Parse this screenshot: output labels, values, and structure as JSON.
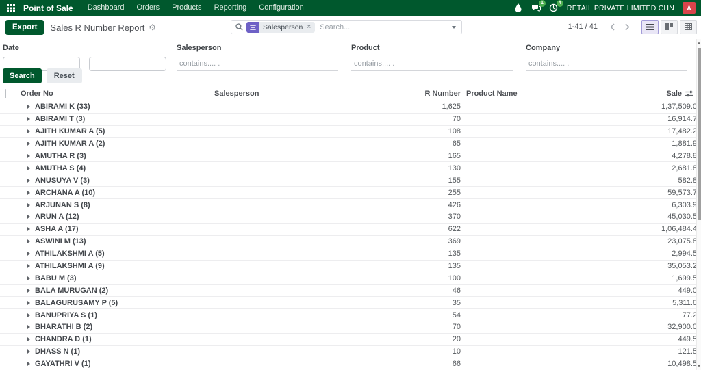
{
  "nav": {
    "app_name": "Point of Sale",
    "menus": [
      "Dashboard",
      "Orders",
      "Products",
      "Reporting",
      "Configuration"
    ],
    "messages_badge": "1",
    "activities_badge": "4",
    "company": "RETAIL PRIVATE LIMITED CHN",
    "avatar_letter": "A",
    "colors": {
      "navbar_bg": "#00582d",
      "avatar_bg": "#d9444b",
      "badge_bg": "#4caf50"
    }
  },
  "control_panel": {
    "export_label": "Export",
    "title": "Sales R Number Report",
    "gear_icon": "⚙",
    "search": {
      "facet_label": "Salesperson",
      "facet_remove": "×",
      "placeholder": "Search...",
      "facet_color": "#6e61c6"
    },
    "pager": {
      "text": "1-41 / 41"
    }
  },
  "filters": {
    "date": {
      "label": "Date"
    },
    "salesperson": {
      "label": "Salesperson",
      "placeholder": "contains.... ."
    },
    "product": {
      "label": "Product",
      "placeholder": "contains.... ."
    },
    "company": {
      "label": "Company",
      "placeholder": "contains.... ."
    },
    "search_button": "Search",
    "reset_button": "Reset"
  },
  "table": {
    "columns": {
      "order_no": "Order No",
      "salesperson": "Salesperson",
      "r_number": "R Number",
      "product_name": "Product Name",
      "sale": "Sale"
    },
    "groups": [
      {
        "name": "ABIRAMI K (33)",
        "r_number": "1,625",
        "sale": "1,37,509.0"
      },
      {
        "name": "ABIRAMI T (3)",
        "r_number": "70",
        "sale": "16,914.7"
      },
      {
        "name": "AJITH KUMAR A (5)",
        "r_number": "108",
        "sale": "17,482.2"
      },
      {
        "name": "AJITH KUMAR A (2)",
        "r_number": "65",
        "sale": "1,881.9"
      },
      {
        "name": "AMUTHA R (3)",
        "r_number": "165",
        "sale": "4,278.8"
      },
      {
        "name": "AMUTHA S (4)",
        "r_number": "130",
        "sale": "2,681.8"
      },
      {
        "name": "ANUSUYA V (3)",
        "r_number": "155",
        "sale": "582.8"
      },
      {
        "name": "ARCHANA A (10)",
        "r_number": "255",
        "sale": "59,573.7"
      },
      {
        "name": "ARJUNAN S (8)",
        "r_number": "426",
        "sale": "6,303.9"
      },
      {
        "name": "ARUN A (12)",
        "r_number": "370",
        "sale": "45,030.5"
      },
      {
        "name": "ASHA A (17)",
        "r_number": "622",
        "sale": "1,06,484.4"
      },
      {
        "name": "ASWINI M (13)",
        "r_number": "369",
        "sale": "23,075.8"
      },
      {
        "name": "ATHILAKSHMI A (5)",
        "r_number": "135",
        "sale": "2,994.5"
      },
      {
        "name": "ATHILAKSHMI A (9)",
        "r_number": "135",
        "sale": "35,053.2"
      },
      {
        "name": "BABU M (3)",
        "r_number": "100",
        "sale": "1,699.5"
      },
      {
        "name": "BALA MURUGAN (2)",
        "r_number": "46",
        "sale": "449.0"
      },
      {
        "name": "BALAGURUSAMY P (5)",
        "r_number": "35",
        "sale": "5,311.6"
      },
      {
        "name": "BANUPRIYA S (1)",
        "r_number": "54",
        "sale": "77.2"
      },
      {
        "name": "BHARATHI B (2)",
        "r_number": "70",
        "sale": "32,900.0"
      },
      {
        "name": "CHANDRA D (1)",
        "r_number": "20",
        "sale": "449.5"
      },
      {
        "name": "DHASS N (1)",
        "r_number": "10",
        "sale": "121.5"
      },
      {
        "name": "GAYATHRI V (1)",
        "r_number": "66",
        "sale": "10,498.5"
      }
    ]
  }
}
